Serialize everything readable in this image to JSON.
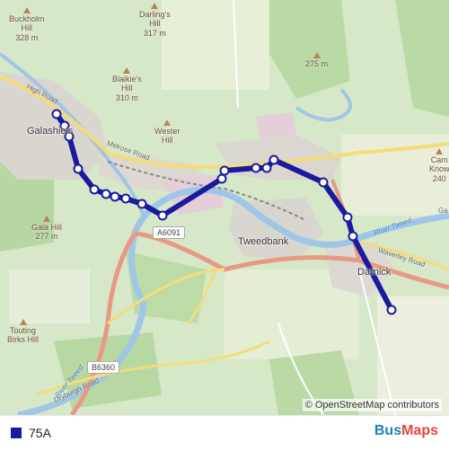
{
  "map": {
    "attribution": "© OpenStreetMap contributors",
    "towns": [
      {
        "key": "galashiels",
        "name": "Galashiels"
      },
      {
        "key": "tweedbank",
        "name": "Tweedbank"
      },
      {
        "key": "darnick",
        "name": "Darnick"
      }
    ],
    "hills": [
      {
        "key": "buckholm",
        "name": "Buckholm\nHill",
        "height": "328 m"
      },
      {
        "key": "darlings",
        "name": "Darling's\nHill",
        "height": "317 m"
      },
      {
        "key": "blaikies",
        "name": "Blaikie's\nHill",
        "height": "310 m"
      },
      {
        "key": "wester",
        "name": "Wester\nHill",
        "height": ""
      },
      {
        "key": "gala",
        "name": "Gala Hill",
        "height": "277 m"
      },
      {
        "key": "touting",
        "name": "Touting\nBirks Hill",
        "height": ""
      },
      {
        "key": "unnamed275",
        "name": "",
        "height": "275 m"
      },
      {
        "key": "camknow",
        "name": "Cam\nKnow",
        "height": "240"
      }
    ],
    "roads": {
      "high_road": "High Road",
      "melrose_road": "Melrose Road",
      "waverley_road": "Waverley Road",
      "a6091": "A6091",
      "b6360": "B6360",
      "dryburgh": "Dryburgh Road"
    },
    "rivers": {
      "tweed_east": "River Tweed",
      "tweed_south": "River Tweed",
      "gala": "Gala"
    },
    "edge_label": "Ga",
    "route_color": "#1a1a9e",
    "route_stops": 16
  },
  "legend": {
    "route": "75A",
    "color": "#1a1a9e"
  },
  "brand": {
    "part1": "Bus",
    "part2": "Maps"
  }
}
